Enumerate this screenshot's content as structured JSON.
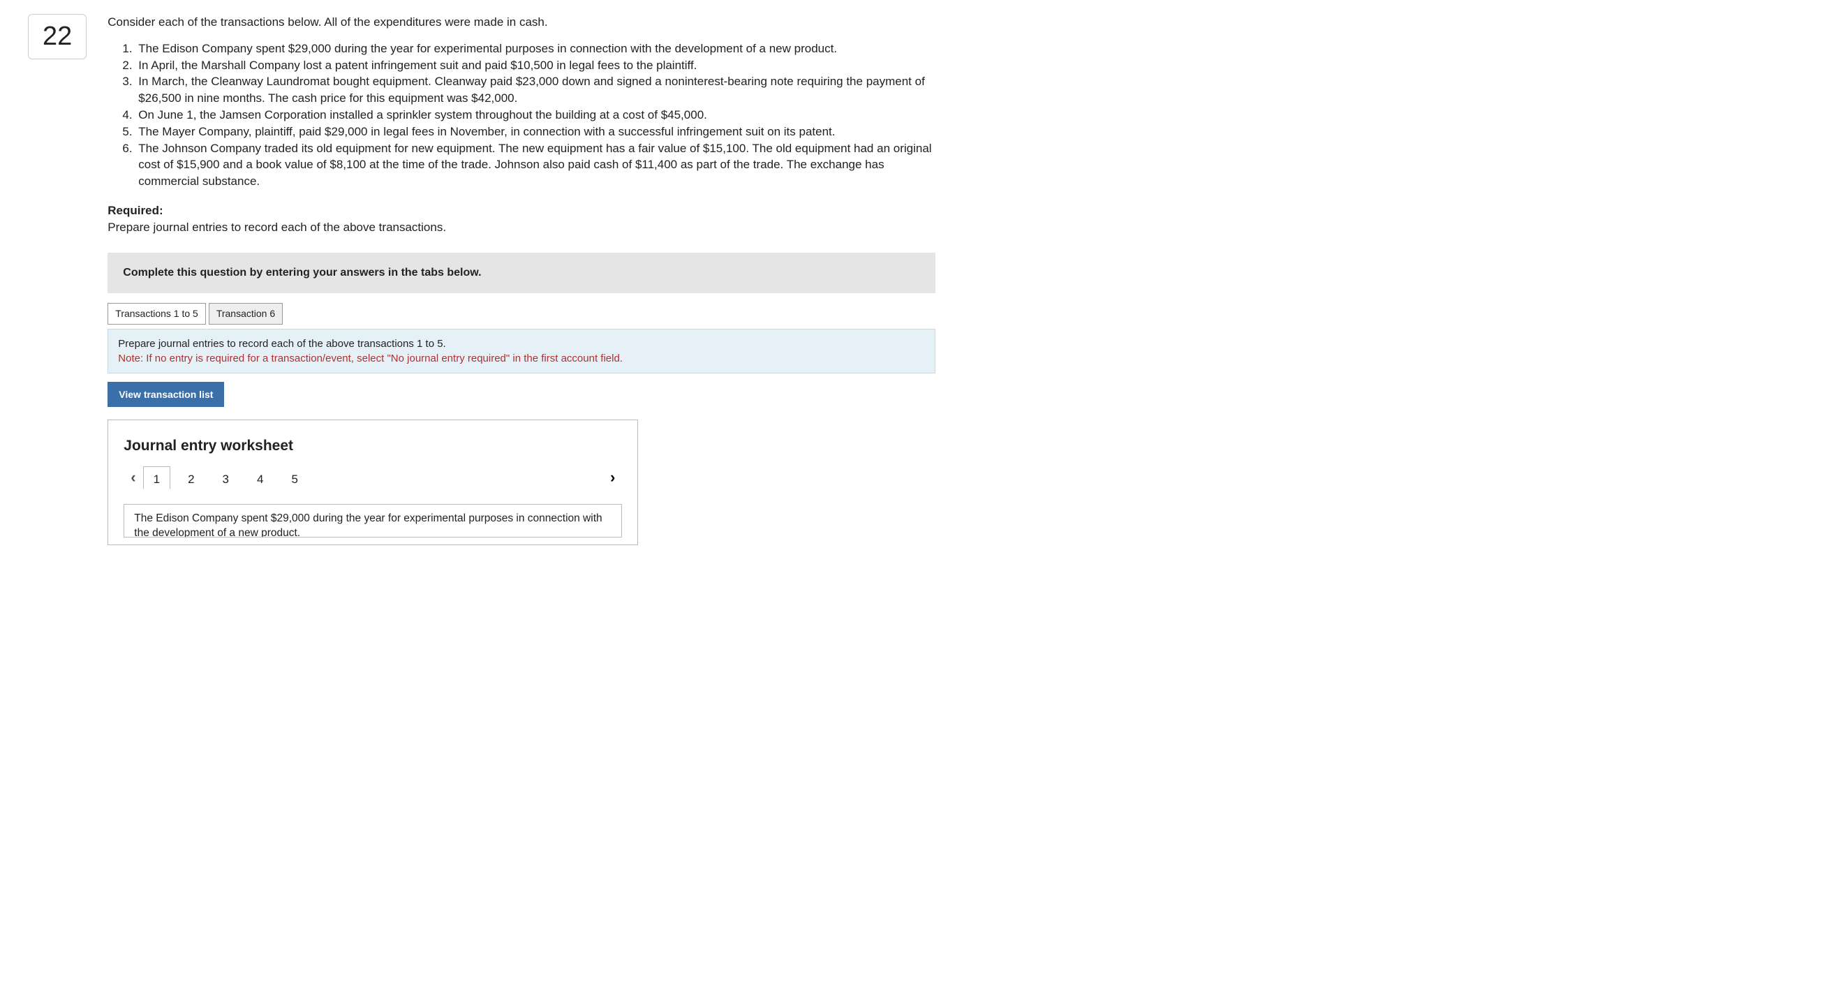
{
  "question_number": "22",
  "intro": "Consider each of the transactions below. All of the expenditures were made in cash.",
  "items": [
    "The Edison Company spent $29,000 during the year for experimental purposes in connection with the development of a new product.",
    "In April, the Marshall Company lost a patent infringement suit and paid $10,500 in legal fees to the plaintiff.",
    "In March, the Cleanway Laundromat bought equipment. Cleanway paid $23,000 down and signed a noninterest-bearing note requiring the payment of $26,500 in nine months. The cash price for this equipment was $42,000.",
    "On June 1, the Jamsen Corporation installed a sprinkler system throughout the building at a cost of $45,000.",
    "The Mayer Company, plaintiff, paid $29,000 in legal fees in November, in connection with a successful infringement suit on its patent.",
    "The Johnson Company traded its old equipment for new equipment. The new equipment has a fair value of $15,100. The old equipment had an original cost of $15,900 and a book value of $8,100 at the time of the trade. Johnson also paid cash of $11,400 as part of the trade. The exchange has commercial substance."
  ],
  "required_label": "Required:",
  "required_text": "Prepare journal entries to record each of the above transactions.",
  "banner": "Complete this question by entering your answers in the tabs below.",
  "tabs": [
    {
      "label": "Transactions 1 to 5"
    },
    {
      "label": "Transaction 6"
    }
  ],
  "instruction_line1": "Prepare journal entries to record each of the above transactions 1 to 5.",
  "instruction_note": "Note: If no entry is required for a transaction/event, select \"No journal entry required\" in the first account field.",
  "view_btn": "View transaction list",
  "worksheet": {
    "title": "Journal entry worksheet",
    "pages": [
      "1",
      "2",
      "3",
      "4",
      "5"
    ],
    "active_page": "1",
    "description": "The Edison Company spent $29,000 during the year for experimental purposes in connection with the development of a new product."
  }
}
